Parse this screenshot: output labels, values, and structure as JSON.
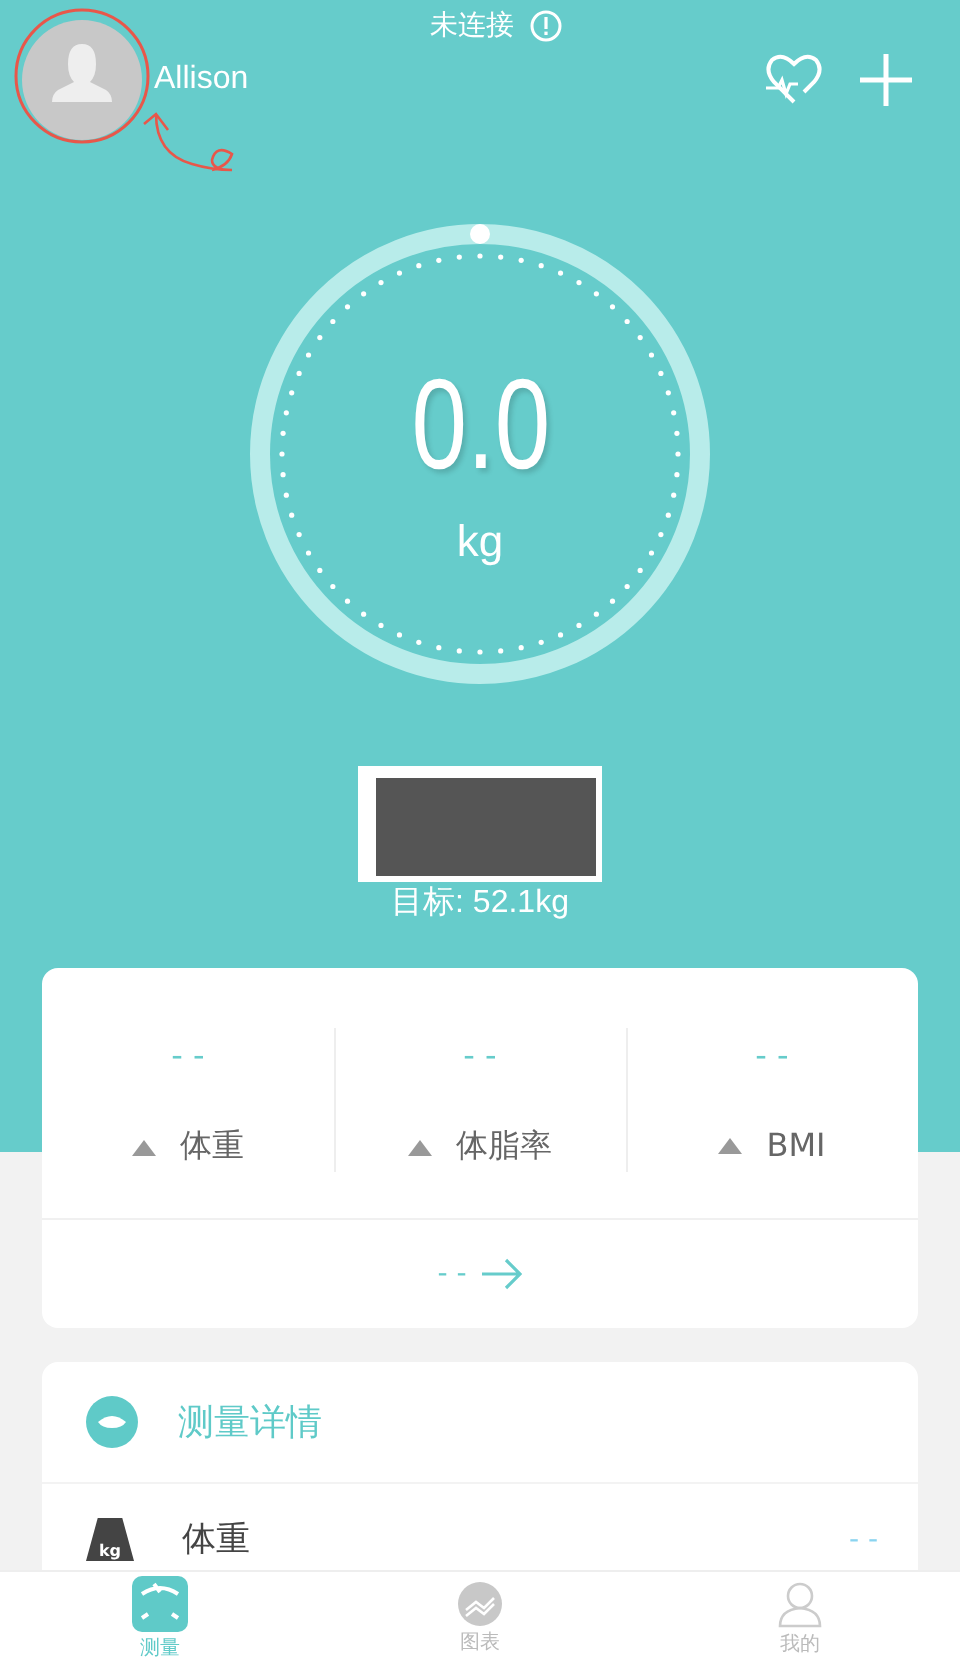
{
  "status": {
    "text": "未连接"
  },
  "user": {
    "name": "Allison"
  },
  "gauge": {
    "value": "0.0",
    "unit": "kg"
  },
  "goal": {
    "text": "目标: 52.1kg"
  },
  "metrics": [
    {
      "value": "- -",
      "label": "体重"
    },
    {
      "value": "- -",
      "label": "体脂率"
    },
    {
      "value": "- -",
      "label": "BMI"
    }
  ],
  "trend": {
    "value": "- -"
  },
  "details": {
    "title": "测量详情",
    "rows": [
      {
        "icon_text": "kg",
        "label": "体重",
        "value": "- -"
      }
    ]
  },
  "nav": [
    {
      "label": "测量",
      "kind": "scale",
      "selected": true
    },
    {
      "label": "图表",
      "kind": "chart",
      "selected": false
    },
    {
      "label": "我的",
      "kind": "profile",
      "selected": false
    }
  ]
}
